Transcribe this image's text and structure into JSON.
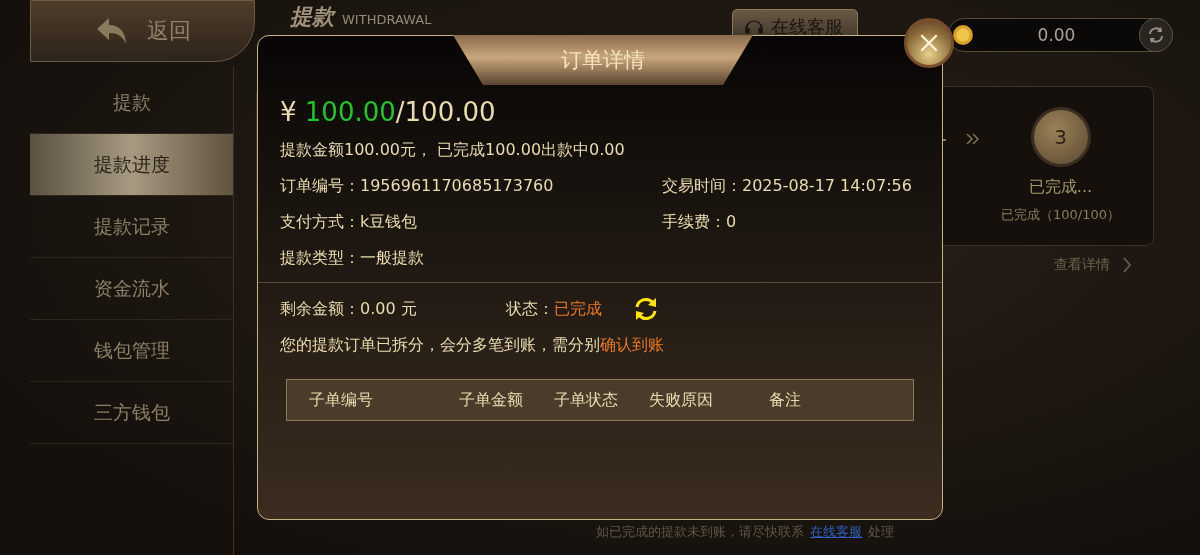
{
  "header": {
    "back_button": "返回",
    "title": "提款",
    "subtitle": "WITHDRAWAL",
    "service_button": "在线客服",
    "balance": "0.00"
  },
  "sidebar": {
    "items": [
      {
        "label": "提款",
        "selected": false
      },
      {
        "label": "提款进度",
        "selected": true
      },
      {
        "label": "提款记录",
        "selected": false
      },
      {
        "label": "资金流水",
        "selected": false
      },
      {
        "label": "钱包管理",
        "selected": false
      },
      {
        "label": "三方钱包",
        "selected": false
      }
    ]
  },
  "progress": {
    "step_number": "3",
    "step_title": "已完成...",
    "step_detail": "已完成（100/100）",
    "details_link": "查看详情"
  },
  "footer_note": {
    "text": "如已完成的提款未到账，请尽快联系",
    "link": "在线客服",
    "suffix": "处理"
  },
  "dialog": {
    "title": "订单详情",
    "currency": "¥",
    "paid_amount": "100.00",
    "total_amount": "/100.00",
    "summary": "提款金额100.00元， 已完成100.00出款中0.00",
    "fields": [
      {
        "label": "订单编号：",
        "value": "1956961170685173760"
      },
      {
        "label": "交易时间：",
        "value": "2025-08-17 14:07:56"
      },
      {
        "label": "支付方式：",
        "value": "k豆钱包"
      },
      {
        "label": "手续费：",
        "value": "0"
      },
      {
        "label": "提款类型：",
        "value": "一般提款"
      }
    ],
    "remaining": {
      "label": "剩余金额：",
      "value": "0.00 元"
    },
    "status": {
      "label": "状态：",
      "value": "已完成"
    },
    "notice": "您的提款订单已拆分，会分多笔到账，需分别",
    "notice_action": "确认到账",
    "table": {
      "columns": [
        "子单编号",
        "子单金额",
        "子单状态",
        "失败原因",
        "备注"
      ]
    }
  }
}
